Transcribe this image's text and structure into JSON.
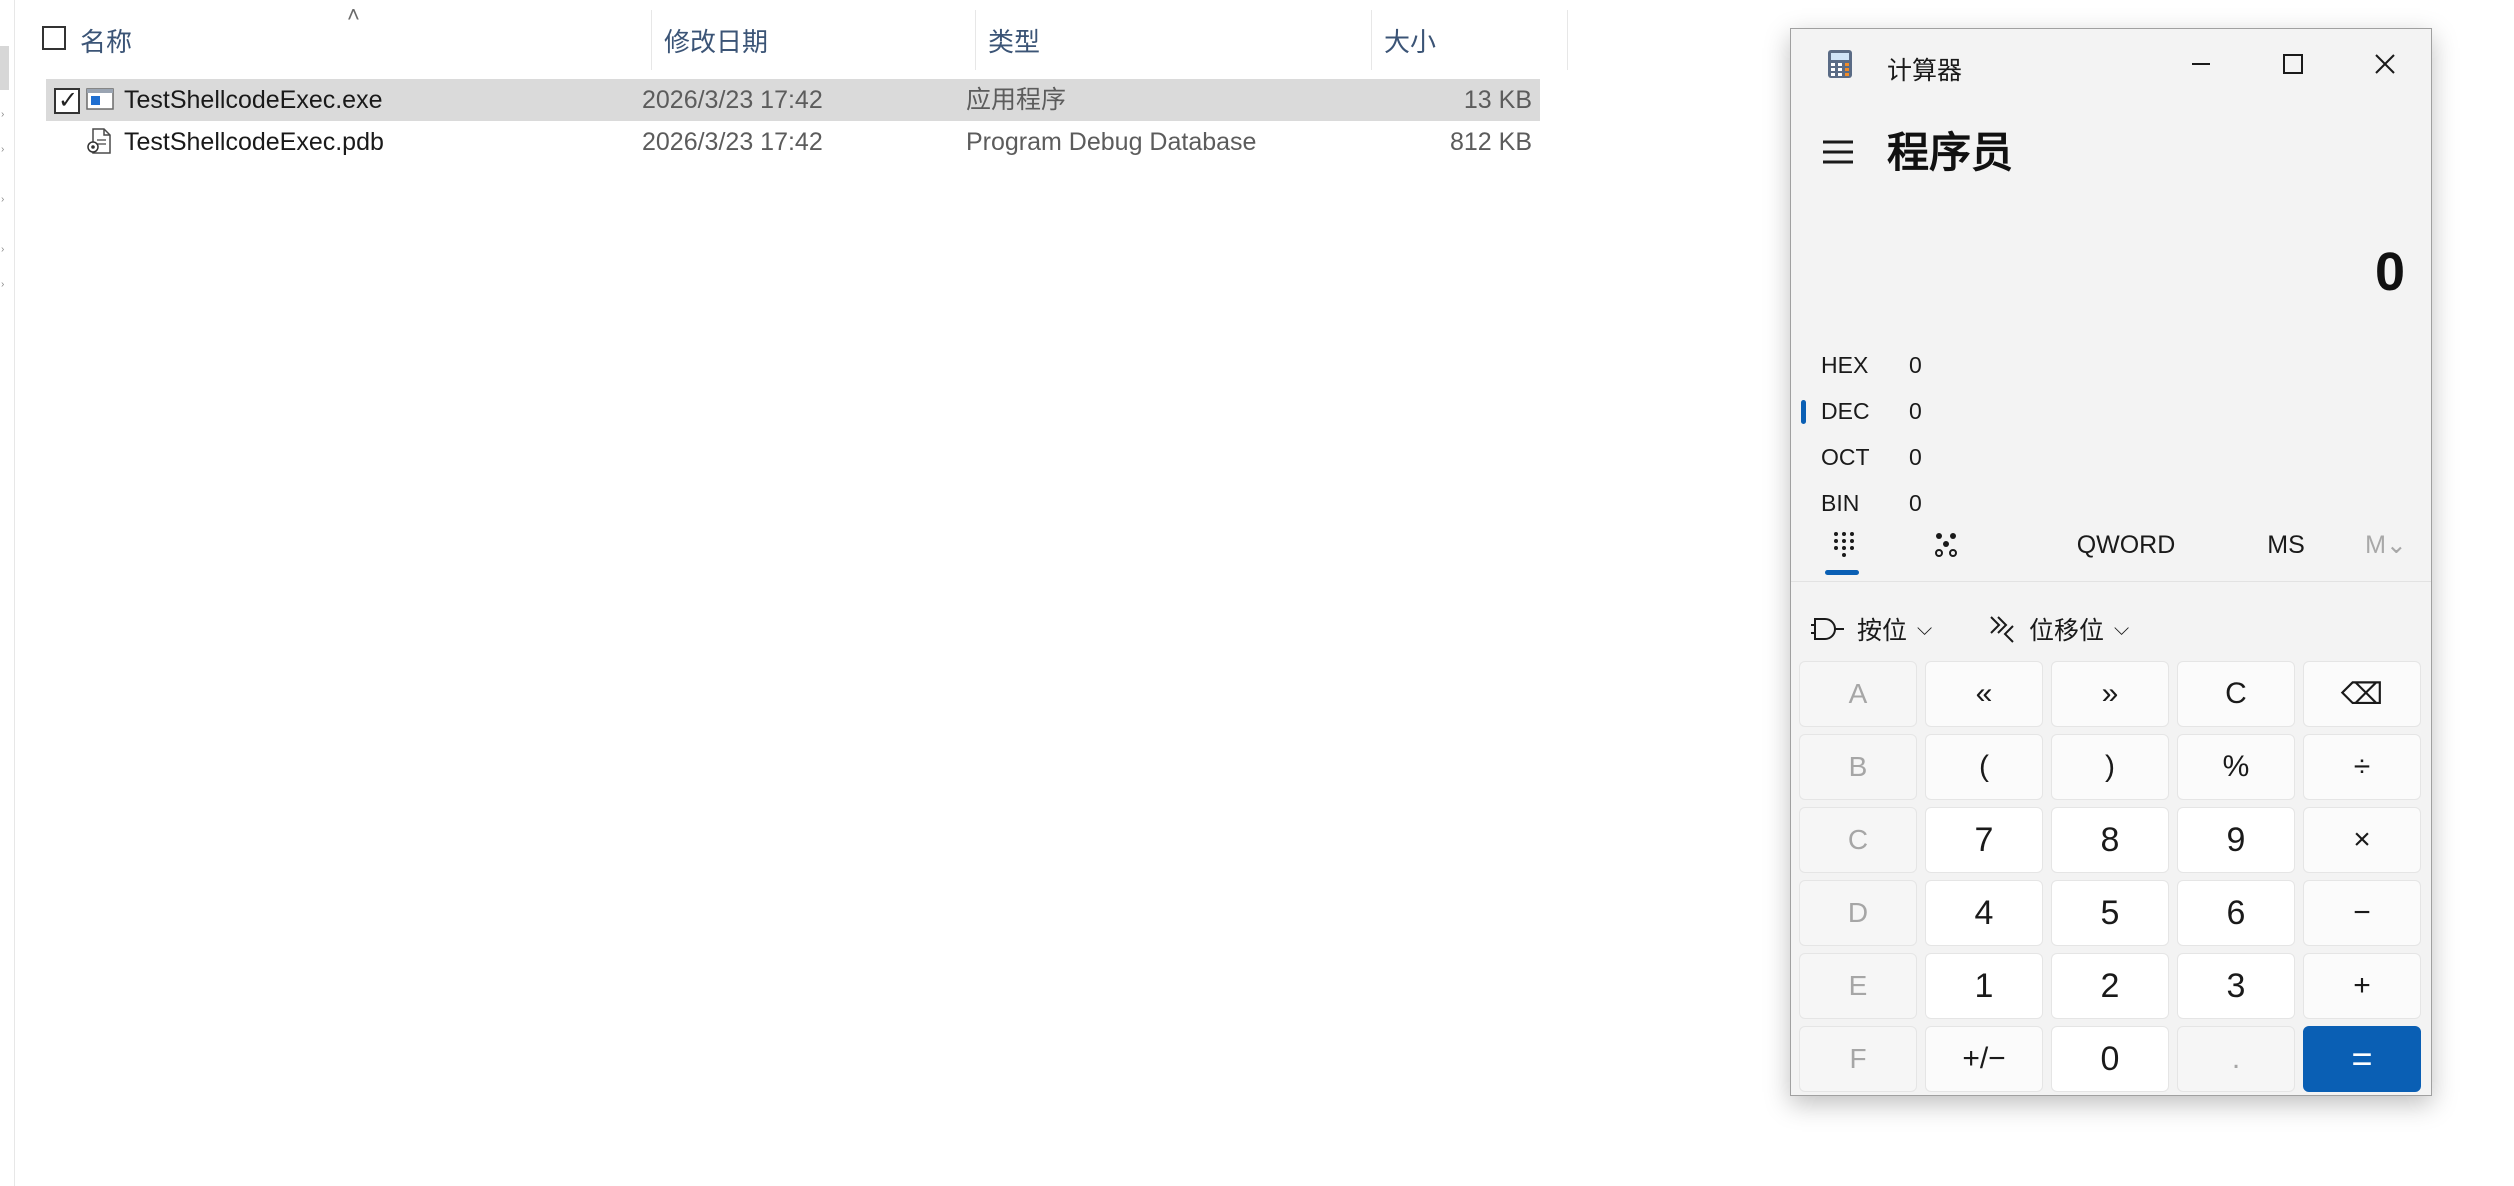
{
  "explorer": {
    "columns": {
      "name": "名称",
      "modified": "修改日期",
      "type": "类型",
      "size": "大小"
    },
    "files": [
      {
        "name": "TestShellcodeExec.exe",
        "modified": "2026/3/23 17:42",
        "type": "应用程序",
        "size": "13 KB",
        "icon": "exe-file-icon",
        "selected": true
      },
      {
        "name": "TestShellcodeExec.pdb",
        "modified": "2026/3/23 17:42",
        "type": "Program Debug Database",
        "size": "812 KB",
        "icon": "pdb-file-icon",
        "selected": false
      }
    ]
  },
  "calculator": {
    "title": "计算器",
    "mode": "程序员",
    "display": "0",
    "radix": [
      {
        "label": "HEX",
        "value": "0",
        "active": false
      },
      {
        "label": "DEC",
        "value": "0",
        "active": true
      },
      {
        "label": "OCT",
        "value": "0",
        "active": false
      },
      {
        "label": "BIN",
        "value": "0",
        "active": false
      }
    ],
    "word_size": "QWORD",
    "ms_label": "MS",
    "mv_label": "M⌄",
    "bitwise_label": "按位",
    "shift_label": "位移位",
    "accent": "#0a5fb4",
    "keys": [
      "A",
      "«",
      "»",
      "C",
      "⌫",
      "B",
      "(",
      ")",
      "%",
      "÷",
      "C",
      "7",
      "8",
      "9",
      "×",
      "D",
      "4",
      "5",
      "6",
      "−",
      "E",
      "1",
      "2",
      "3",
      "+",
      "F",
      "+/−",
      "0",
      ".",
      "="
    ]
  }
}
